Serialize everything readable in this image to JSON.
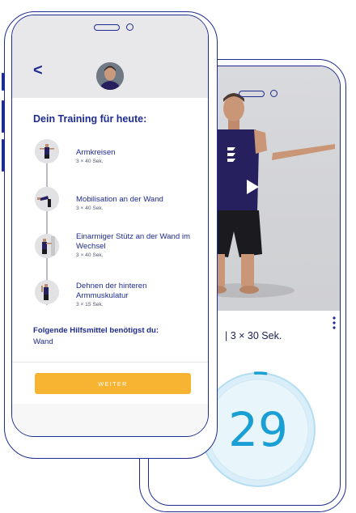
{
  "training_screen": {
    "back_symbol": "<",
    "title": "Dein Training für heute:",
    "exercises": [
      {
        "name": "Armkreisen",
        "detail": "3 × 40 Sek."
      },
      {
        "name": "Mobilisation an der Wand",
        "detail": "3 × 40 Sek."
      },
      {
        "name": "Einarmiger Stütz an der Wand im Wechsel",
        "detail": "3 × 40 Sek."
      },
      {
        "name": "Dehnen der hinteren Armmuskulatur",
        "detail": "3 × 15 Sek."
      }
    ],
    "equipment_title": "Folgende Hilfsmittel benötigst du:",
    "equipment_value": "Wand",
    "continue_label": "WEITER"
  },
  "video_screen": {
    "set_info": "| 3 × 30 Sek.",
    "timer_value": "29",
    "timer_progress": 0.03
  },
  "colors": {
    "outline": "#1e2b8f",
    "accent_button": "#f7b433",
    "timer_blue": "#1a9fd4"
  }
}
